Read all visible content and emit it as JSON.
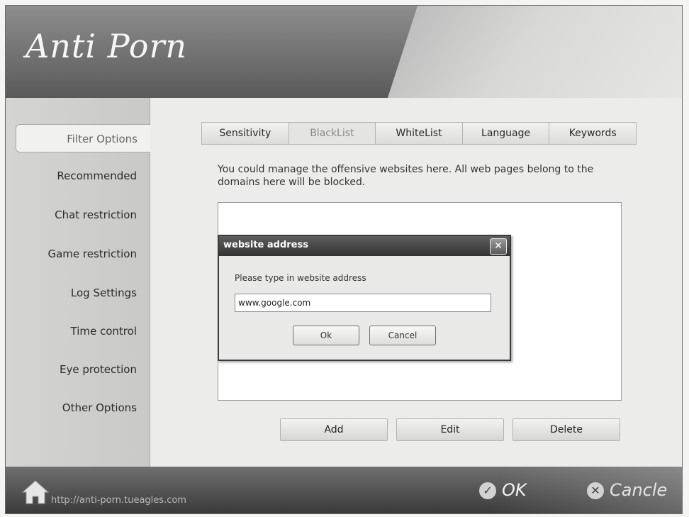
{
  "app": {
    "title": "Anti Porn"
  },
  "sidebar": {
    "items": [
      {
        "label": "Filter Options"
      },
      {
        "label": "Recommended"
      },
      {
        "label": "Chat restriction"
      },
      {
        "label": "Game restriction"
      },
      {
        "label": "Log Settings"
      },
      {
        "label": "Time control"
      },
      {
        "label": "Eye protection"
      },
      {
        "label": "Other Options"
      }
    ]
  },
  "tabs": [
    {
      "label": "Sensitivity"
    },
    {
      "label": "BlackList"
    },
    {
      "label": "WhiteList"
    },
    {
      "label": "Language"
    },
    {
      "label": "Keywords"
    }
  ],
  "main": {
    "description": "You could manage the offensive websites here. All web pages belong to the domains here will be blocked.",
    "buttons": {
      "add": "Add",
      "edit": "Edit",
      "delete": "Delete"
    }
  },
  "dialog": {
    "title": "website address",
    "close_glyph": "✕",
    "prompt": "Please type in website address",
    "input_value": "www.google.com",
    "ok_label": "Ok",
    "cancel_label": "Cancel"
  },
  "footer": {
    "url": "http://anti-porn.tueagles.com",
    "ok_label": "OK",
    "cancel_label": "Cancle",
    "ok_glyph": "✓",
    "cancel_glyph": "✕"
  },
  "colors": {
    "header": "#5a5a5a",
    "footer": "#3a3a3a",
    "dialog_title": "#333333"
  },
  "icons": {
    "home": "home-icon",
    "ok": "check-icon",
    "cancel": "close-circle-icon"
  }
}
